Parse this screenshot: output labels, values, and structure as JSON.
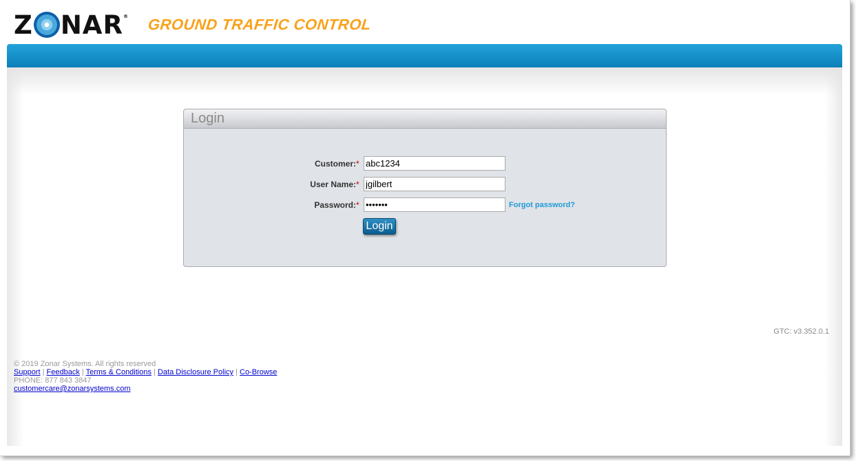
{
  "header": {
    "logo_text": "ZONAR",
    "app_title": "GROUND TRAFFIC CONTROL"
  },
  "login": {
    "title": "Login",
    "customer_label": "Customer:",
    "customer_value": "abc1234",
    "username_label": "User Name:",
    "username_value": "jgilbert",
    "password_label": "Password:",
    "password_value": "•••••••",
    "required_marker": "*",
    "forgot_link": "Forgot password?",
    "login_button": "Login"
  },
  "version": "GTC: v3.352.0.1",
  "footer": {
    "copyright": "© 2019 Zonar Systems. All rights reserved",
    "links": [
      "Support",
      "Feedback",
      "Terms & Conditions",
      "Data Disclosure Policy",
      "Co-Browse"
    ],
    "separator": " | ",
    "phone": "PHONE: 877 843 3847",
    "email": "customercare@zonarsystems.com"
  },
  "colors": {
    "accent_bar": "#1a95cf",
    "brand_orange": "#f7a21b",
    "link": "#0000cc"
  }
}
